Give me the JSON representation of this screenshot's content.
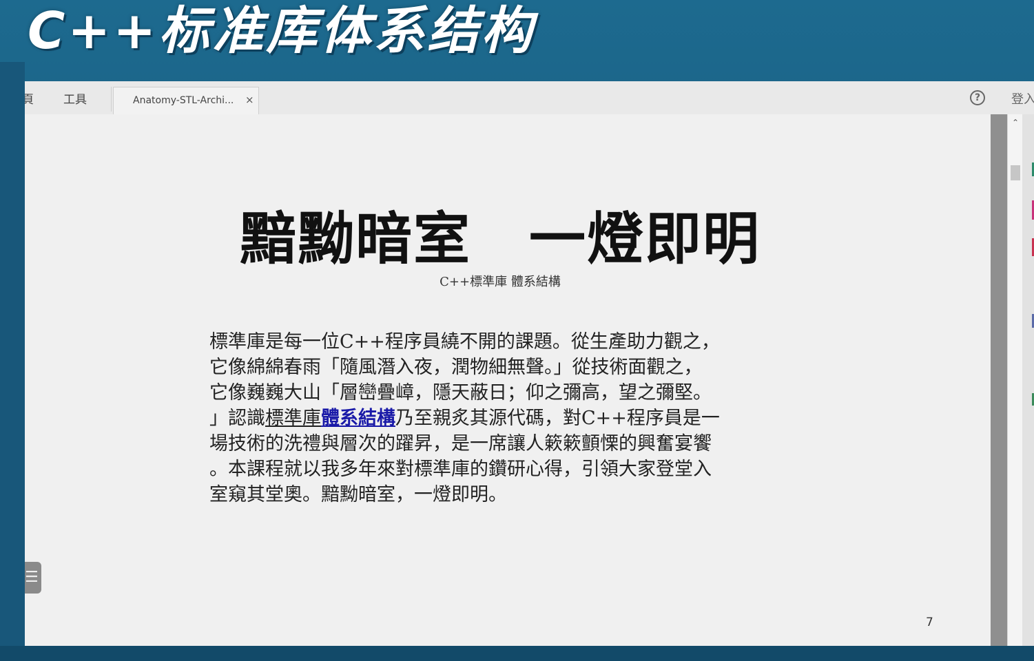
{
  "banner": {
    "title": "C++标准库体系结构"
  },
  "viewer": {
    "menu": {
      "home_label": "頁",
      "tools_label": "工具"
    },
    "tab": {
      "label": "Anatomy-STL-Archi...",
      "close_glyph": "×"
    },
    "help_glyph": "?",
    "login_label": "登入",
    "side_handle_glyph": "☰",
    "scroll_up_glyph": "⌃"
  },
  "page": {
    "title": "黯黝暗室　一燈即明",
    "subtitle": "C++標準庫 體系結構",
    "body": {
      "line1": "標準庫是每一位C++程序員繞不開的課題。從生產助力觀之，",
      "line2": "它像綿綿春雨「隨風潛入夜，潤物細無聲。」從技術面觀之，",
      "line3": "它像巍巍大山「層巒疊嶂，隱天蔽日；仰之彌高，望之彌堅。",
      "line4_before": "」認識",
      "line4_underlined": "標準庫",
      "line4_link": "體系結構",
      "line4_after": "乃至親炙其源代碼，對C++程序員是一",
      "line5": "場技術的洗禮與層次的躍昇，是一席讓人簌簌顫慄的興奮宴饗",
      "line6": "。本課程就以我多年來對標準庫的鑽研心得，引領大家登堂入",
      "line7": "室窺其堂奧。黯黝暗室，一燈即明。"
    },
    "page_number": "7"
  },
  "colors": {
    "banner_bg": "#1d6a8f",
    "link": "#1a1aa8",
    "page_bg": "#f0f0f0"
  }
}
